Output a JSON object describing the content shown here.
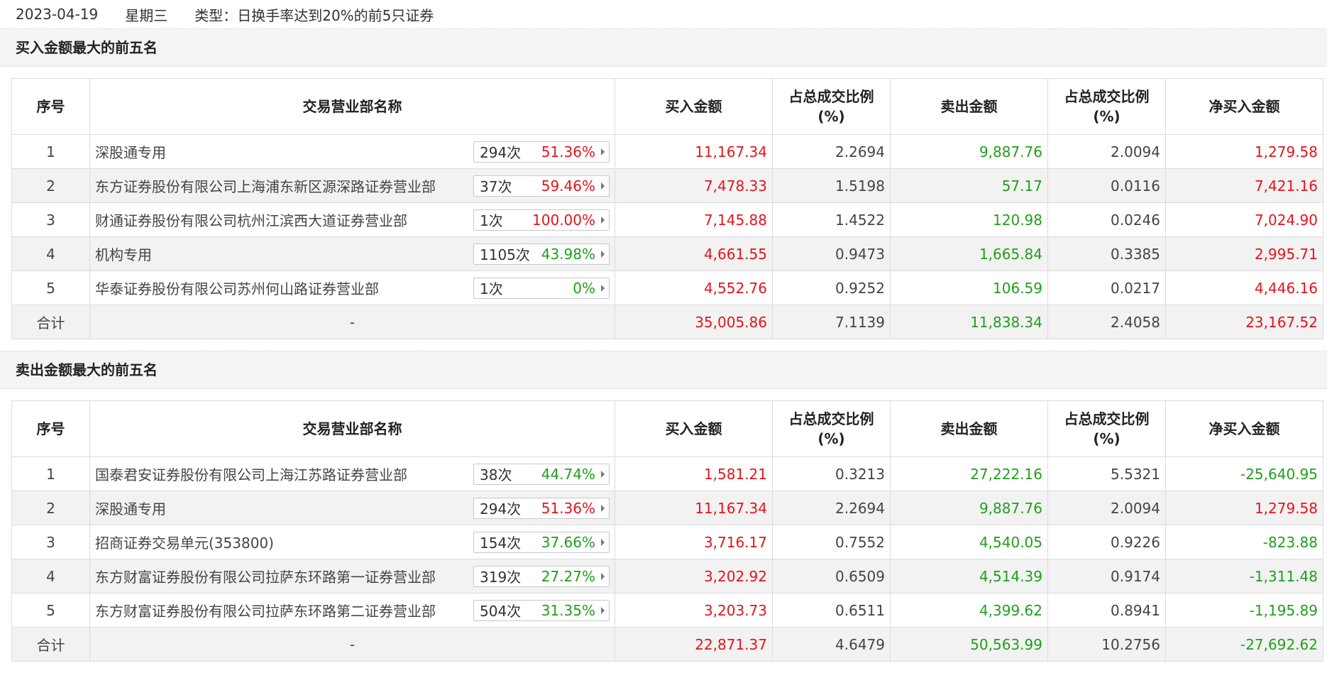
{
  "header": {
    "date": "2023-04-19",
    "weekday": "星期三",
    "type": "类型：日换手率达到20%的前5只证券"
  },
  "columns": {
    "seq": "序号",
    "name": "交易营业部名称",
    "buy": "买入金额",
    "buy_pct_1": "占总成交比例",
    "buy_pct_2": "(%)",
    "sell": "卖出金额",
    "sell_pct_1": "占总成交比例",
    "sell_pct_2": "(%)",
    "net": "净买入金额"
  },
  "buy_section": {
    "title": "买入金额最大的前五名",
    "rows": [
      {
        "seq": "1",
        "name": "深股通专用",
        "count": "294次",
        "pct": "51.36%",
        "pct_color": "red",
        "buy": "11,167.34",
        "buy_pct": "2.2694",
        "sell": "9,887.76",
        "sell_pct": "2.0094",
        "net": "1,279.58",
        "net_color": "red"
      },
      {
        "seq": "2",
        "name": "东方证券股份有限公司上海浦东新区源深路证券营业部",
        "count": "37次",
        "pct": "59.46%",
        "pct_color": "red",
        "buy": "7,478.33",
        "buy_pct": "1.5198",
        "sell": "57.17",
        "sell_pct": "0.0116",
        "net": "7,421.16",
        "net_color": "red"
      },
      {
        "seq": "3",
        "name": "财通证券股份有限公司杭州江滨西大道证券营业部",
        "count": "1次",
        "pct": "100.00%",
        "pct_color": "red",
        "buy": "7,145.88",
        "buy_pct": "1.4522",
        "sell": "120.98",
        "sell_pct": "0.0246",
        "net": "7,024.90",
        "net_color": "red"
      },
      {
        "seq": "4",
        "name": "机构专用",
        "count": "1105次",
        "pct": "43.98%",
        "pct_color": "green",
        "buy": "4,661.55",
        "buy_pct": "0.9473",
        "sell": "1,665.84",
        "sell_pct": "0.3385",
        "net": "2,995.71",
        "net_color": "red"
      },
      {
        "seq": "5",
        "name": "华泰证券股份有限公司苏州何山路证券营业部",
        "count": "1次",
        "pct": "0%",
        "pct_color": "green",
        "buy": "4,552.76",
        "buy_pct": "0.9252",
        "sell": "106.59",
        "sell_pct": "0.0217",
        "net": "4,446.16",
        "net_color": "red"
      }
    ],
    "total": {
      "label": "合计",
      "name": "-",
      "buy": "35,005.86",
      "buy_pct": "7.1139",
      "sell": "11,838.34",
      "sell_pct": "2.4058",
      "net": "23,167.52",
      "net_color": "red"
    }
  },
  "sell_section": {
    "title": "卖出金额最大的前五名",
    "rows": [
      {
        "seq": "1",
        "name": "国泰君安证券股份有限公司上海江苏路证券营业部",
        "count": "38次",
        "pct": "44.74%",
        "pct_color": "green",
        "buy": "1,581.21",
        "buy_pct": "0.3213",
        "sell": "27,222.16",
        "sell_pct": "5.5321",
        "net": "-25,640.95",
        "net_color": "green"
      },
      {
        "seq": "2",
        "name": "深股通专用",
        "count": "294次",
        "pct": "51.36%",
        "pct_color": "red",
        "buy": "11,167.34",
        "buy_pct": "2.2694",
        "sell": "9,887.76",
        "sell_pct": "2.0094",
        "net": "1,279.58",
        "net_color": "red"
      },
      {
        "seq": "3",
        "name": "招商证券交易单元(353800)",
        "count": "154次",
        "pct": "37.66%",
        "pct_color": "green",
        "buy": "3,716.17",
        "buy_pct": "0.7552",
        "sell": "4,540.05",
        "sell_pct": "0.9226",
        "net": "-823.88",
        "net_color": "green"
      },
      {
        "seq": "4",
        "name": "东方财富证券股份有限公司拉萨东环路第一证券营业部",
        "count": "319次",
        "pct": "27.27%",
        "pct_color": "green",
        "buy": "3,202.92",
        "buy_pct": "0.6509",
        "sell": "4,514.39",
        "sell_pct": "0.9174",
        "net": "-1,311.48",
        "net_color": "green"
      },
      {
        "seq": "5",
        "name": "东方财富证券股份有限公司拉萨东环路第二证券营业部",
        "count": "504次",
        "pct": "31.35%",
        "pct_color": "green",
        "buy": "3,203.73",
        "buy_pct": "0.6511",
        "sell": "4,399.62",
        "sell_pct": "0.8941",
        "net": "-1,195.89",
        "net_color": "green"
      }
    ],
    "total": {
      "label": "合计",
      "name": "-",
      "buy": "22,871.37",
      "buy_pct": "4.6479",
      "sell": "50,563.99",
      "sell_pct": "10.2756",
      "net": "-27,692.62",
      "net_color": "green"
    }
  }
}
